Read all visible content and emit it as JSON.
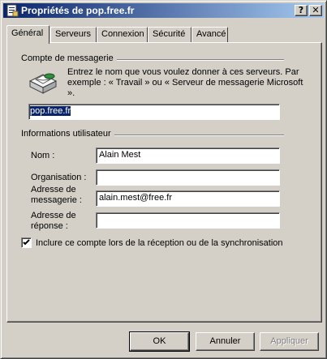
{
  "window": {
    "title": "Propriétés de pop.free.fr",
    "help_button": "?",
    "close_button": "✕"
  },
  "tabs": [
    {
      "label": "Général",
      "active": true
    },
    {
      "label": "Serveurs",
      "active": false
    },
    {
      "label": "Connexion",
      "active": false
    },
    {
      "label": "Sécurité",
      "active": false
    },
    {
      "label": "Avancé",
      "active": false
    }
  ],
  "mail_account": {
    "group_title": "Compte de messagerie",
    "icon": "mail-account-icon",
    "description": "Entrez le nom que vous voulez donner à ces serveurs. Par exemple : « Travail » ou « Serveur de messagerie Microsoft ».",
    "account_name": "pop.free.fr"
  },
  "user_info": {
    "group_title": "Informations utilisateur",
    "name_label": "Nom :",
    "name_value": "Alain Mest",
    "organization_label": "Organisation :",
    "organization_value": "",
    "email_label_line1": "Adresse de",
    "email_label_line2": "messagerie :",
    "email_value": "alain.mest@free.fr",
    "reply_label_line1": "Adresse de",
    "reply_label_line2": "réponse :",
    "reply_value": ""
  },
  "include_account": {
    "checked": true,
    "label": "Inclure ce compte lors de la réception ou de la synchronisation"
  },
  "buttons": {
    "ok": "OK",
    "cancel": "Annuler",
    "apply": "Appliquer"
  }
}
